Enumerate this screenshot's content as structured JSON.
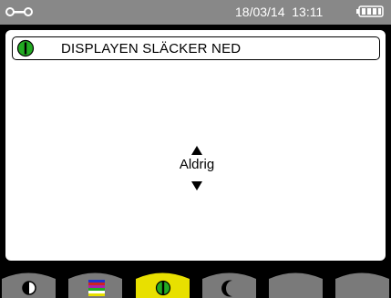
{
  "status_bar": {
    "datetime": "18/03/14  13:11",
    "icons": [
      "wrench-icon",
      "battery-icon"
    ]
  },
  "setting": {
    "title": "DISPLAYEN SLÄCKER NED",
    "icon": "power-icon",
    "value": "Aldrig"
  },
  "tabs": [
    {
      "icon": "contrast-icon"
    },
    {
      "icon": "colors-icon"
    },
    {
      "icon": "power-icon",
      "selected": true
    },
    {
      "icon": "moon-icon"
    },
    {
      "icon": ""
    },
    {
      "icon": ""
    }
  ],
  "colors": {
    "accent": "#e8e000",
    "power_green": "#22aa22",
    "tab_gray": "#7a7a7a"
  }
}
